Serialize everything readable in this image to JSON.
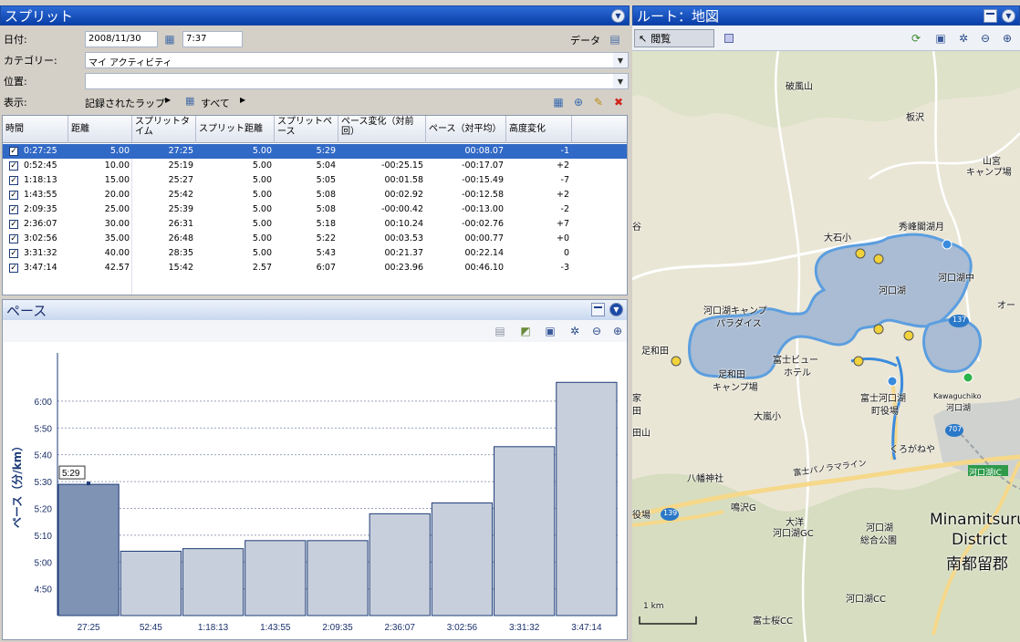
{
  "splits": {
    "title": "スプリット",
    "date_label": "日付:",
    "date_value": "2008/11/30",
    "time_value": "7:37",
    "data_label": "データ",
    "category_label": "カテゴリー:",
    "category_value": "マイ アクティビティ",
    "location_label": "位置:",
    "location_value": "",
    "display_label": "表示:",
    "display_laps": "記録されたラップ",
    "display_all": "すべて",
    "columns": [
      "時間",
      "距離",
      "スプリットタイム",
      "スプリット距離",
      "スプリットペース",
      "ペース変化（対前回）",
      "ペース（対平均）",
      "高度変化"
    ],
    "rows": [
      {
        "time": "0:27:25",
        "dist": "5.00",
        "stime": "27:25",
        "sdist": "5.00",
        "space": "5:29",
        "dprev": "",
        "davg": "00:08.07",
        "elev": "-1"
      },
      {
        "time": "0:52:45",
        "dist": "10.00",
        "stime": "25:19",
        "sdist": "5.00",
        "space": "5:04",
        "dprev": "-00:25.15",
        "davg": "-00:17.07",
        "elev": "+2"
      },
      {
        "time": "1:18:13",
        "dist": "15.00",
        "stime": "25:27",
        "sdist": "5.00",
        "space": "5:05",
        "dprev": "00:01.58",
        "davg": "-00:15.49",
        "elev": "-7"
      },
      {
        "time": "1:43:55",
        "dist": "20.00",
        "stime": "25:42",
        "sdist": "5.00",
        "space": "5:08",
        "dprev": "00:02.92",
        "davg": "-00:12.58",
        "elev": "+2"
      },
      {
        "time": "2:09:35",
        "dist": "25.00",
        "stime": "25:39",
        "sdist": "5.00",
        "space": "5:08",
        "dprev": "-00:00.42",
        "davg": "-00:13.00",
        "elev": "-2"
      },
      {
        "time": "2:36:07",
        "dist": "30.00",
        "stime": "26:31",
        "sdist": "5.00",
        "space": "5:18",
        "dprev": "00:10.24",
        "davg": "-00:02.76",
        "elev": "+7"
      },
      {
        "time": "3:02:56",
        "dist": "35.00",
        "stime": "26:48",
        "sdist": "5.00",
        "space": "5:22",
        "dprev": "00:03.53",
        "davg": "00:00.77",
        "elev": "+0"
      },
      {
        "time": "3:31:32",
        "dist": "40.00",
        "stime": "28:35",
        "sdist": "5.00",
        "space": "5:43",
        "dprev": "00:21.37",
        "davg": "00:22.14",
        "elev": "0"
      },
      {
        "time": "3:47:14",
        "dist": "42.57",
        "stime": "15:42",
        "sdist": "2.57",
        "space": "6:07",
        "dprev": "00:23.96",
        "davg": "00:46.10",
        "elev": "-3"
      }
    ]
  },
  "pace_panel": {
    "title": "ペース",
    "tooltip": "5:29"
  },
  "chart_data": {
    "type": "bar",
    "categories": [
      "27:25",
      "52:45",
      "1:18:13",
      "1:43:55",
      "2:09:35",
      "2:36:07",
      "3:02:56",
      "3:31:32",
      "3:47:14"
    ],
    "values": [
      5.483,
      5.067,
      5.083,
      5.133,
      5.133,
      5.3,
      5.367,
      5.717,
      6.117
    ],
    "value_labels": [
      "5:29",
      "5:04",
      "5:05",
      "5:08",
      "5:08",
      "5:18",
      "5:22",
      "5:43",
      "6:07"
    ],
    "ylabel": "ペース（分/km）",
    "ylim": [
      4.667,
      6.3
    ],
    "y_ticks": [
      4.833,
      5.0,
      5.167,
      5.333,
      5.5,
      5.667,
      5.833,
      6.0
    ],
    "y_tick_labels": [
      "4:50",
      "5:00",
      "5:10",
      "5:20",
      "5:30",
      "5:40",
      "5:50",
      "6:00"
    ],
    "highlight_index": 0,
    "colors": {
      "bar": "#c8cfdc",
      "bar_highlight": "#7f93b5",
      "bar_edge": "#1d3c78"
    },
    "grid": true
  },
  "map_panel": {
    "title": "ルート：地図",
    "browse_label": "閲覧",
    "labels": {
      "hafu": "破風山",
      "itazawa": "板沢",
      "yamamiya": "山宮",
      "camp": "キャンプ場",
      "ooishi": "大石小",
      "shuhou": "秀峰閣湖月",
      "kawaguchiko_lake": "河口湖",
      "kawaguchi_naka": "河口湖中",
      "camp_paradise": "河口湖キャンプ",
      "paradise": "パラダイス",
      "fuji_view": "富士ビュー",
      "hotel": "ホテル",
      "ashiwada": "足和田",
      "ashiwada_camp": "足和田",
      "camp2": "キャンプ場",
      "kawaguchi_town": "富士河口湖",
      "town_office": "町役場",
      "kawaguchiko_station": "Kawaguchiko",
      "kawaguchiko_jp": "河口湖",
      "oonishi": "大嵐小",
      "kurogane": "くろがねや",
      "panorama": "富士パノラマライン",
      "hachiman": "八幡神社",
      "narusawa": "鳴沢G",
      "taiyo": "大洋",
      "kawaguchi_gc": "河口湖GC",
      "kawaguchi_park": "河口湖",
      "park2": "総合公園",
      "kawaguchi_cc": "河口湖CC",
      "fujizakura": "富士桜CC",
      "minamitsuru1": "Minamitsuru",
      "minamitsuru2": "District",
      "minamitsuru3": "南都留郡",
      "ic": "河口湖IC",
      "scale": "1 km",
      "route137": "137",
      "route707": "707",
      "route139": "139",
      "yakuba": "役場",
      "ta": "田山",
      "ie": "家",
      "ni": "谷",
      "ta2": "田",
      "oo": "オー"
    }
  }
}
